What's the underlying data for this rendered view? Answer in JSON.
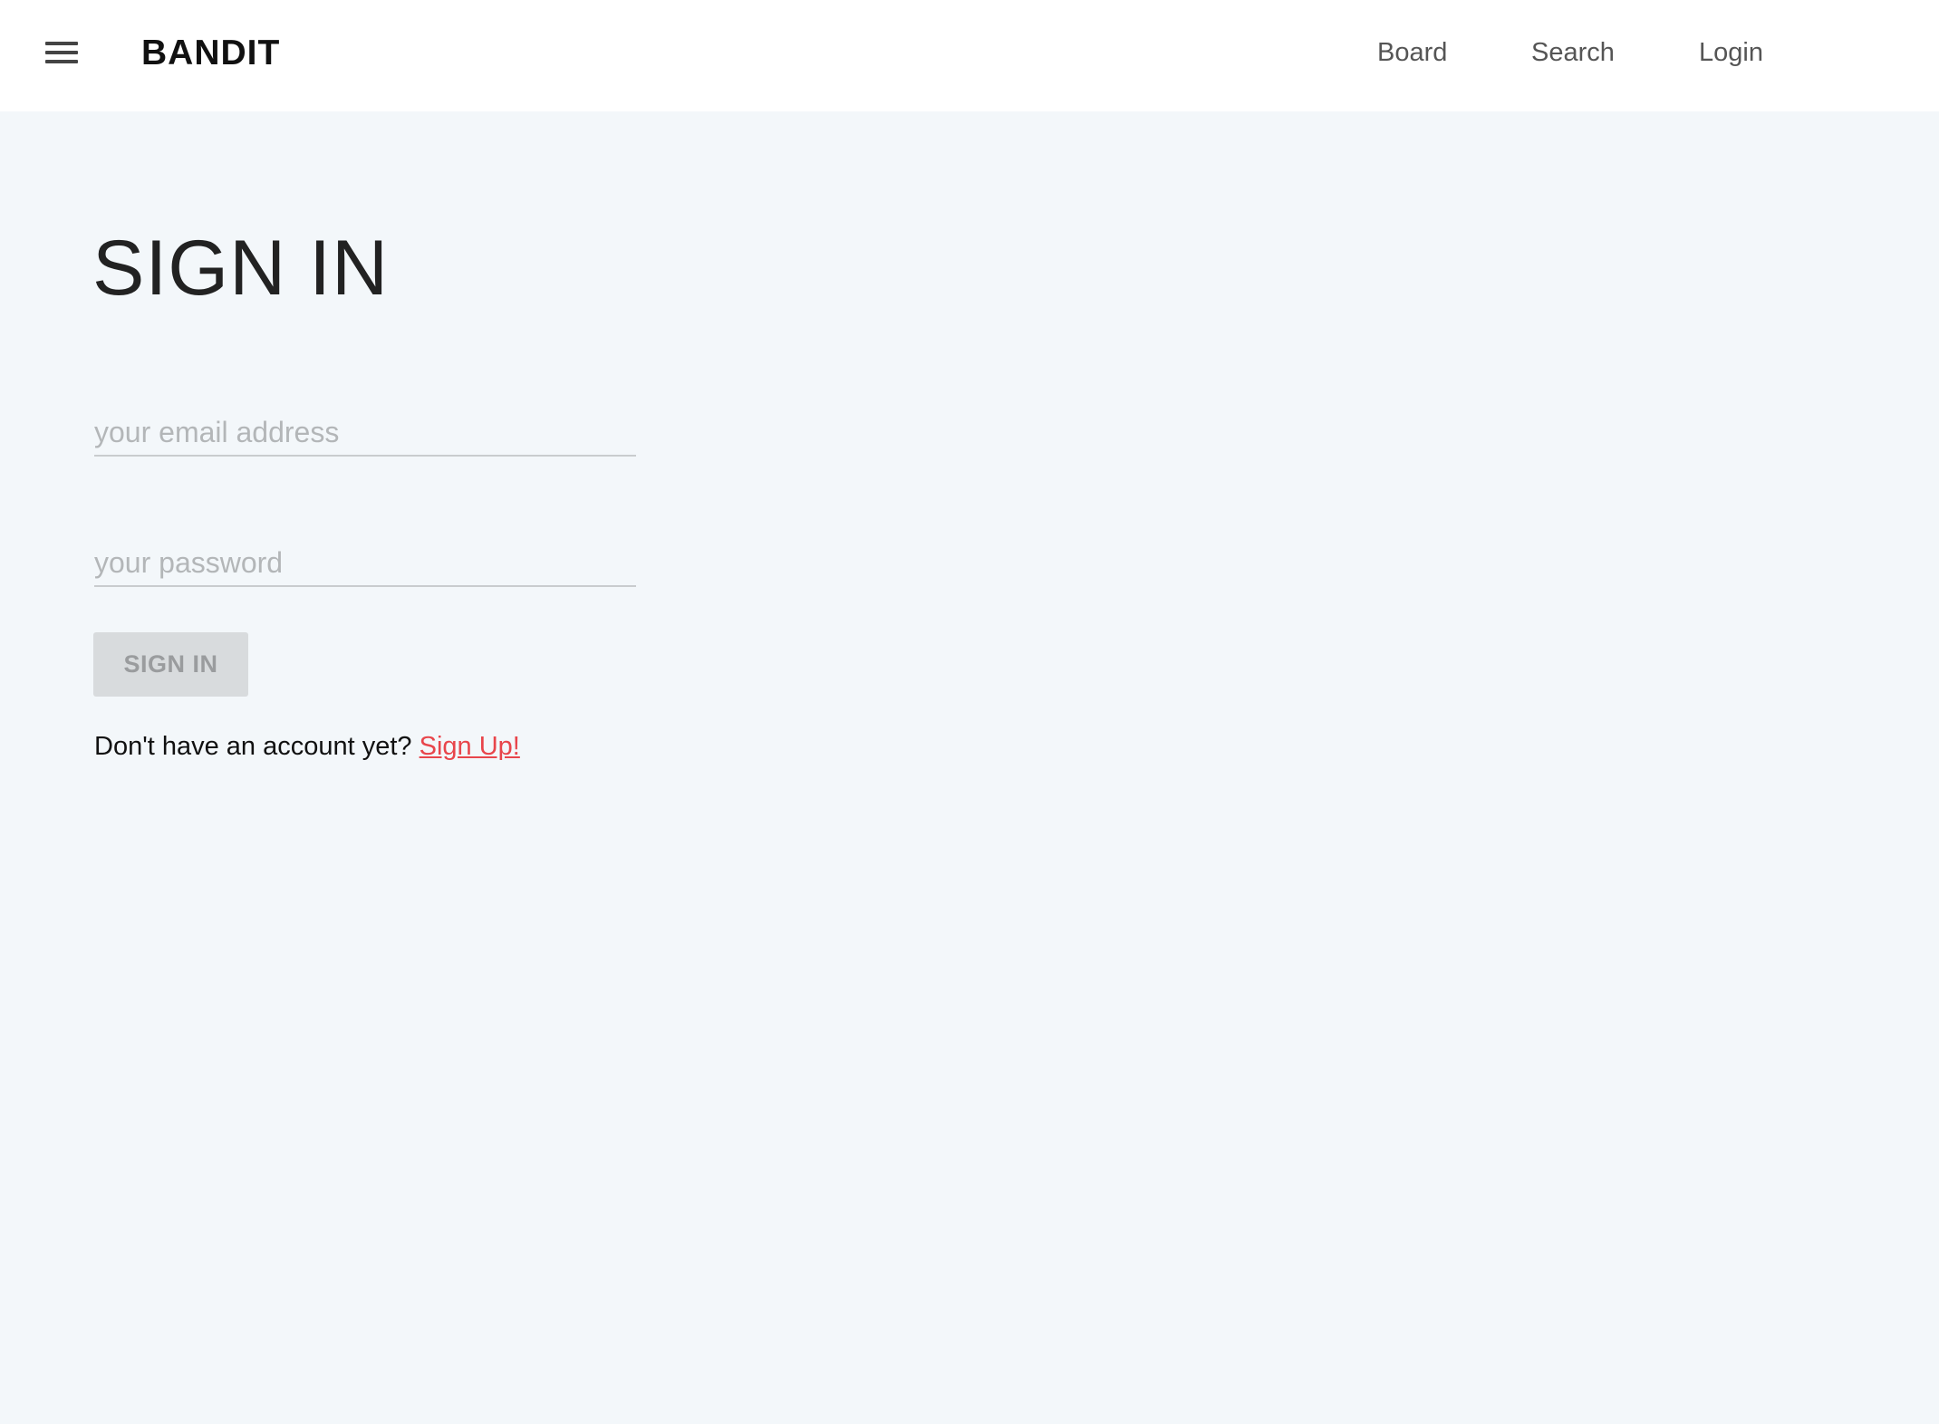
{
  "header": {
    "menu_icon": "hamburger-menu-icon",
    "brand": "BANDIT",
    "nav": {
      "board": "Board",
      "search": "Search",
      "login": "Login"
    }
  },
  "main": {
    "title": "SIGN IN",
    "email": {
      "value": "",
      "placeholder": "your email address"
    },
    "password": {
      "value": "",
      "placeholder": "your password"
    },
    "submit_label": "SIGN IN",
    "signup_prompt": "Don't have an account yet?",
    "signup_link": "Sign Up!"
  },
  "colors": {
    "background": "#f3f7fa",
    "header_background": "#ffffff",
    "link_accent": "#e8454b",
    "button_disabled_bg": "#d8dbdd"
  }
}
